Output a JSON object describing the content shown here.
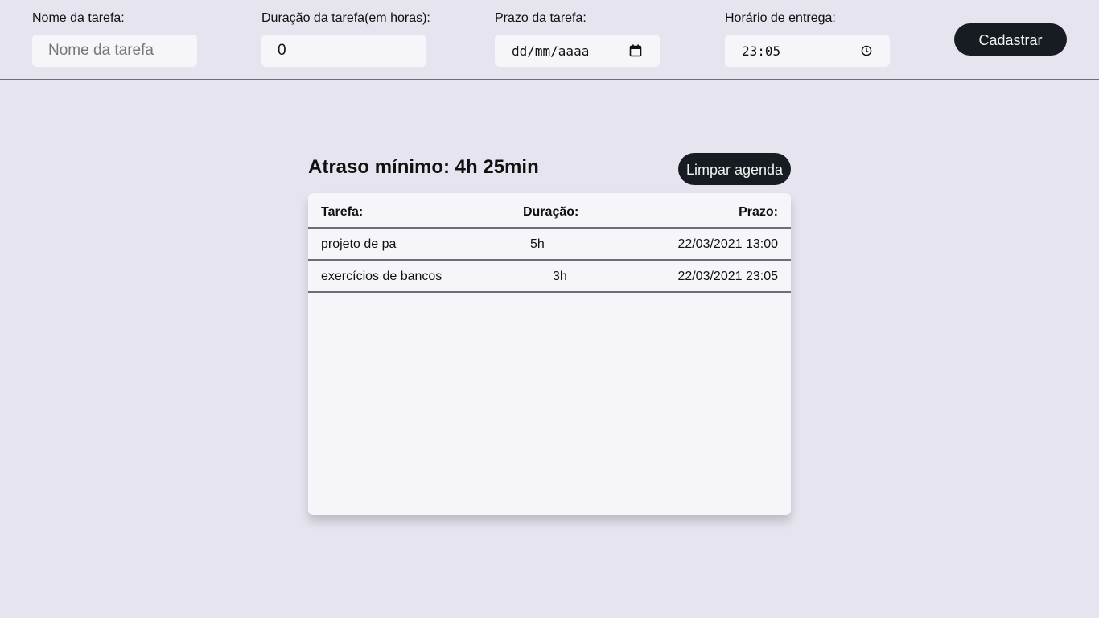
{
  "form": {
    "name_label": "Nome da tarefa:",
    "name_placeholder": "Nome da tarefa",
    "duration_label": "Duração da tarefa(em horas):",
    "duration_value": "0",
    "deadline_label": "Prazo da tarefa:",
    "deadline_value": "dd/mm/aaaa",
    "time_label": "Horário de entrega:",
    "time_value": "23:05",
    "submit_label": "Cadastrar"
  },
  "schedule": {
    "title": "Atraso mínimo: 4h 25min",
    "clear_label": "Limpar agenda",
    "headers": [
      "Tarefa:",
      "Duração:",
      "Prazo:"
    ],
    "rows": [
      {
        "task": "projeto de pa",
        "duration": "5h",
        "deadline": "22/03/2021 13:00"
      },
      {
        "task": "exercícios de bancos",
        "duration": "3h",
        "deadline": "22/03/2021 23:05"
      }
    ]
  },
  "icons": {
    "calendar": "calendar-icon",
    "clock": "clock-icon"
  },
  "colors": {
    "background": "#e6e4ee",
    "input_background": "#f6f5fa",
    "button_background": "#171b22",
    "button_text": "#f2f2f2",
    "divider": "#6f6d78"
  }
}
